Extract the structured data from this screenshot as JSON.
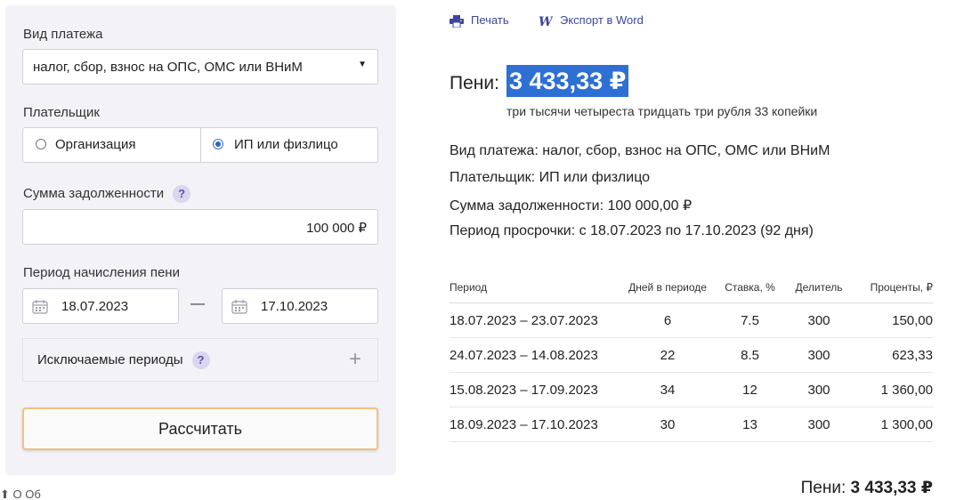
{
  "form": {
    "payment_type_label": "Вид платежа",
    "payment_type_value": "налог, сбор, взнос на ОПС, ОМС или ВНиМ",
    "payer_label": "Плательщик",
    "payer_options": [
      "Организация",
      "ИП или физлицо"
    ],
    "payer_selected": "ИП или физлицо",
    "debt_label": "Сумма задолженности",
    "help_mark": "?",
    "debt_value": "100 000 ₽",
    "period_label": "Период начисления пени",
    "date_from": "18.07.2023",
    "date_sep": "—",
    "date_to": "17.10.2023",
    "excluded_label": "Исключаемые периоды",
    "calc_button": "Рассчитать",
    "below_text": "⬆  О                                               Об"
  },
  "toolbar": {
    "print_label": "Печать",
    "word_label": "Экспорт в Word"
  },
  "result": {
    "peni_label": "Пени:",
    "peni_amount": "3 433,33 ₽",
    "peni_words": "три тысячи четыреста тридцать три рубля 33 копейки",
    "info_lines": [
      "Вид платежа: налог, сбор, взнос на ОПС, ОМС или ВНиМ",
      "Плательщик: ИП или физлицо",
      "Сумма задолженности: 100 000,00 ₽",
      "Период просрочки: с 18.07.2023 по 17.10.2023 (92 дня)"
    ],
    "table": {
      "headers": [
        "Период",
        "Дней в периоде",
        "Ставка, %",
        "Делитель",
        "Проценты, ₽"
      ],
      "rows": [
        [
          "18.07.2023 – 23.07.2023",
          "6",
          "7.5",
          "300",
          "150,00"
        ],
        [
          "24.07.2023 – 14.08.2023",
          "22",
          "8.5",
          "300",
          "623,33"
        ],
        [
          "15.08.2023 – 17.09.2023",
          "34",
          "12",
          "300",
          "1 360,00"
        ],
        [
          "18.09.2023 – 17.10.2023",
          "30",
          "13",
          "300",
          "1 300,00"
        ]
      ]
    },
    "total_label": "Пени:",
    "total_amount": "3 433,33 ₽"
  },
  "colors": {
    "accent": "#2e6fd4",
    "link": "#3d46a0",
    "button_border": "#f2c27f",
    "panel_bg": "#f3f3f7"
  }
}
